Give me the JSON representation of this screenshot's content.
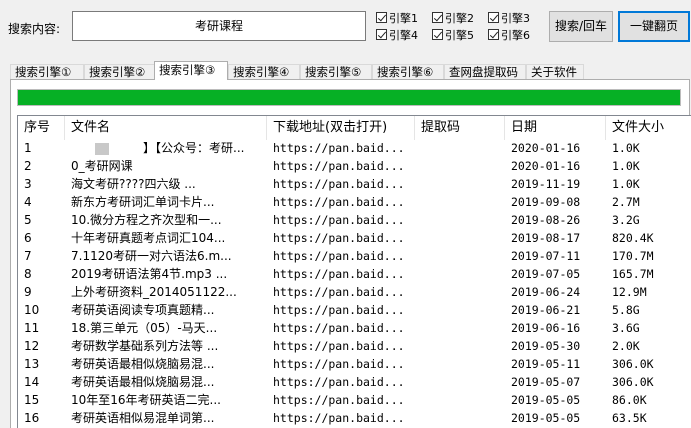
{
  "search": {
    "label": "搜索内容:",
    "value": "考研课程"
  },
  "engines": [
    {
      "label": "引擎1",
      "checked": true
    },
    {
      "label": "引擎2",
      "checked": true
    },
    {
      "label": "引擎3",
      "checked": true
    },
    {
      "label": "引擎4",
      "checked": true
    },
    {
      "label": "引擎5",
      "checked": true
    },
    {
      "label": "引擎6",
      "checked": true
    }
  ],
  "buttons": {
    "search": "搜索/回车",
    "flip": "一键翻页"
  },
  "tabs": [
    {
      "label": "搜索引擎①",
      "active": false
    },
    {
      "label": "搜索引擎②",
      "active": false
    },
    {
      "label": "搜索引擎③",
      "active": true
    },
    {
      "label": "搜索引擎④",
      "active": false
    },
    {
      "label": "搜索引擎⑤",
      "active": false
    },
    {
      "label": "搜索引擎⑥",
      "active": false
    },
    {
      "label": "查网盘提取码",
      "active": false
    },
    {
      "label": "关于软件",
      "active": false
    }
  ],
  "progress": {
    "percent": 100,
    "color": "#06b025"
  },
  "table": {
    "columns": [
      "序号",
      "文件名",
      "下载地址(双击打开)",
      "提取码",
      "日期",
      "文件大小"
    ],
    "rows": [
      [
        "1",
        "】【公众号：考研...",
        "https://pan.baid...",
        "",
        "2020-01-16",
        "1.0K"
      ],
      [
        "2",
        "0_考研网课",
        "https://pan.baid...",
        "",
        "2020-01-16",
        "1.0K"
      ],
      [
        "3",
        "海文考研????四六级        ...",
        "https://pan.baid...",
        "",
        "2019-11-19",
        "1.0K"
      ],
      [
        "4",
        "新东方考研词汇单词卡片...",
        "https://pan.baid...",
        "",
        "2019-09-08",
        "2.7M"
      ],
      [
        "5",
        "10.微分方程之齐次型和一...",
        "https://pan.baid...",
        "",
        "2019-08-26",
        "3.2G"
      ],
      [
        "6",
        "十年考研真题考点词汇104...",
        "https://pan.baid...",
        "",
        "2019-08-17",
        "820.4K"
      ],
      [
        "7",
        "7.1120考研一对六语法6.m...",
        "https://pan.baid...",
        "",
        "2019-07-11",
        "170.7M"
      ],
      [
        "8",
        "2019考研语法第4节.mp3   ...",
        "https://pan.baid...",
        "",
        "2019-07-05",
        "165.7M"
      ],
      [
        "9",
        "上外考研资料_2014051122...",
        "https://pan.baid...",
        "",
        "2019-06-24",
        "12.9M"
      ],
      [
        "10",
        "考研英语阅读专项真题精...",
        "https://pan.baid...",
        "",
        "2019-06-21",
        "5.8G"
      ],
      [
        "11",
        "18.第三单元（05）-马天...",
        "https://pan.baid...",
        "",
        "2019-06-16",
        "3.6G"
      ],
      [
        "12",
        "考研数学基础系列方法等 ...",
        "https://pan.baid...",
        "",
        "2019-05-30",
        "2.0K"
      ],
      [
        "13",
        "考研英语最相似烧脑易混...",
        "https://pan.baid...",
        "",
        "2019-05-11",
        "306.0K"
      ],
      [
        "14",
        "考研英语最相似烧脑易混...",
        "https://pan.baid...",
        "",
        "2019-05-07",
        "306.0K"
      ],
      [
        "15",
        "10年至16年考研英语二完...",
        "https://pan.baid...",
        "",
        "2019-05-05",
        "86.0K"
      ],
      [
        "16",
        "考研英语相似易混单词第...",
        "https://pan.baid...",
        "",
        "2019-05-05",
        "63.5K"
      ]
    ]
  }
}
